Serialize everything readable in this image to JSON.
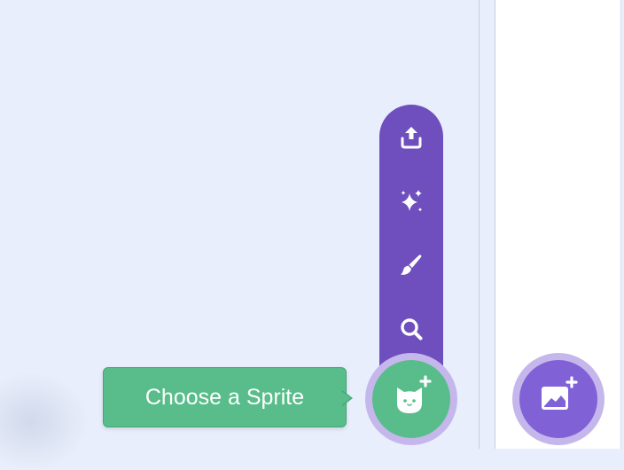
{
  "sprite_menu": {
    "items": [
      {
        "icon": "upload-icon",
        "action": "upload"
      },
      {
        "icon": "sparkles-icon",
        "action": "surprise"
      },
      {
        "icon": "paintbrush-icon",
        "action": "paint"
      },
      {
        "icon": "search-icon",
        "action": "choose"
      }
    ]
  },
  "sprite_button": {
    "icon": "cat-plus-icon",
    "tooltip": "Choose a Sprite"
  },
  "backdrop_button": {
    "icon": "image-plus-icon"
  },
  "colors": {
    "pane_background": "#e8eefb",
    "menu_purple": "#6e4fbd",
    "sprite_green": "#59bd8b",
    "backdrop_purple": "#8161d6",
    "halo": "#c5b7ec"
  }
}
